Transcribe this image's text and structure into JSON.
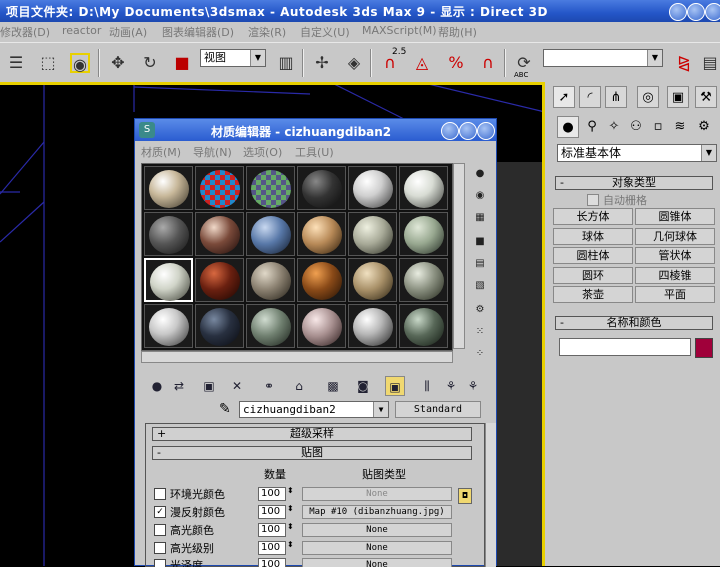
{
  "app": {
    "title": "项目文件夹: D:\\My Documents\\3dsmax      - Autodesk 3ds Max 9      - 显示 : Direct 3D"
  },
  "menubar": {
    "items": [
      "修改器(D)",
      "reactor",
      "动画(A)",
      "图表编辑器(D)",
      "渲染(R)",
      "自定义(U)",
      "MAXScript(M)",
      "帮助(H)"
    ]
  },
  "toolbar": {
    "view_combo": "视图",
    "angle_snap_label": "2.5",
    "percent_snap_label": "%",
    "abc_label": "ABC"
  },
  "command_panel": {
    "category_select": "标准基本体",
    "object_type_header": "对象类型",
    "autogrid_label": "自动栅格",
    "buttons": [
      "长方体",
      "圆锥体",
      "球体",
      "几何球体",
      "圆柱体",
      "管状体",
      "圆环",
      "四棱锥",
      "茶壶",
      "平面"
    ],
    "name_color_header": "名称和颜色",
    "name_value": "",
    "color": "#a0003a"
  },
  "material_editor": {
    "title": "材质编辑器 - cizhuangdiban2",
    "menu": [
      "材质(M)",
      "导航(N)",
      "选项(O)",
      "工具(U)"
    ],
    "material_name": "cizhuangdiban2",
    "type_button": "Standard",
    "supersampling_header": "超级采样",
    "maps_header": "贴图",
    "col_amount": "数量",
    "col_map_type": "贴图类型",
    "maps": [
      {
        "label": "环境光颜色",
        "checked": false,
        "amount": "100",
        "map": "None"
      },
      {
        "label": "漫反射颜色",
        "checked": true,
        "amount": "100",
        "map": "Map #10 (dibanzhuang.jpg)"
      },
      {
        "label": "高光颜色",
        "checked": false,
        "amount": "100",
        "map": "None"
      },
      {
        "label": "高光级别",
        "checked": false,
        "amount": "100",
        "map": "None"
      },
      {
        "label": "光泽度",
        "checked": false,
        "amount": "100",
        "map": "None"
      }
    ]
  },
  "colors": {
    "title_blue": "#2456c8",
    "ui_gray": "#c8c8c8",
    "active_yellow": "#e8d000",
    "viewport_lines": "#2828a8"
  }
}
